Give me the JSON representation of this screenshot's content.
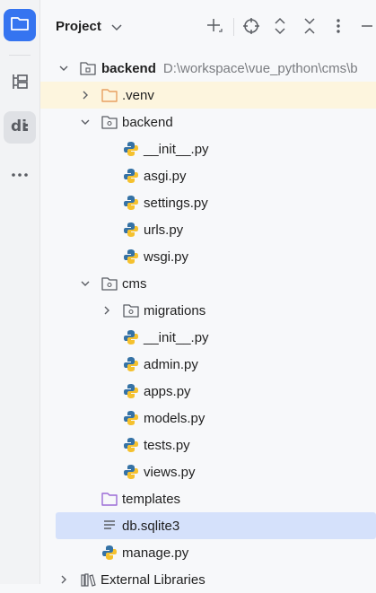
{
  "toolstrip": {
    "items": [
      {
        "name": "project-tool-button",
        "icon": "folder-icon"
      },
      {
        "name": "structure-tool-button",
        "icon": "structure-icon"
      },
      {
        "name": "django-tool-button",
        "icon": "django-icon"
      },
      {
        "name": "more-tool-windows-button",
        "icon": "more-horizontal-icon"
      }
    ]
  },
  "header": {
    "title": "Project",
    "actions": [
      "add-icon",
      "locate-icon",
      "expand-all-icon",
      "collapse-all-icon",
      "options-icon",
      "minimize-icon"
    ]
  },
  "tree": {
    "rows": [
      {
        "label": "backend",
        "path": "D:\\workspace\\vue_python\\cms\\b",
        "icon": "module-folder-icon",
        "expanded": true
      },
      {
        "label": ".venv",
        "icon": "excluded-folder-icon",
        "expanded": false
      },
      {
        "label": "backend",
        "icon": "package-folder-icon",
        "expanded": true
      },
      {
        "label": "__init__.py",
        "icon": "python-file-icon"
      },
      {
        "label": "asgi.py",
        "icon": "python-file-icon"
      },
      {
        "label": "settings.py",
        "icon": "python-file-icon"
      },
      {
        "label": "urls.py",
        "icon": "python-file-icon"
      },
      {
        "label": "wsgi.py",
        "icon": "python-file-icon"
      },
      {
        "label": "cms",
        "icon": "package-folder-icon",
        "expanded": true
      },
      {
        "label": "migrations",
        "icon": "package-folder-icon",
        "expanded": false
      },
      {
        "label": "__init__.py",
        "icon": "python-file-icon"
      },
      {
        "label": "admin.py",
        "icon": "python-file-icon"
      },
      {
        "label": "apps.py",
        "icon": "python-file-icon"
      },
      {
        "label": "models.py",
        "icon": "python-file-icon"
      },
      {
        "label": "tests.py",
        "icon": "python-file-icon"
      },
      {
        "label": "views.py",
        "icon": "python-file-icon"
      },
      {
        "label": "templates",
        "icon": "templates-folder-icon"
      },
      {
        "label": "db.sqlite3",
        "icon": "text-file-icon",
        "selected": true
      },
      {
        "label": "manage.py",
        "icon": "python-file-icon"
      },
      {
        "label": "External Libraries",
        "icon": "library-icon",
        "expanded": false
      }
    ]
  },
  "colors": {
    "accent": "#3574f0",
    "selection": "#d5e1fb",
    "excluded_highlight": "#fdf5de",
    "templates_folder": "#9b6bd6",
    "excluded_folder": "#e8a060"
  }
}
